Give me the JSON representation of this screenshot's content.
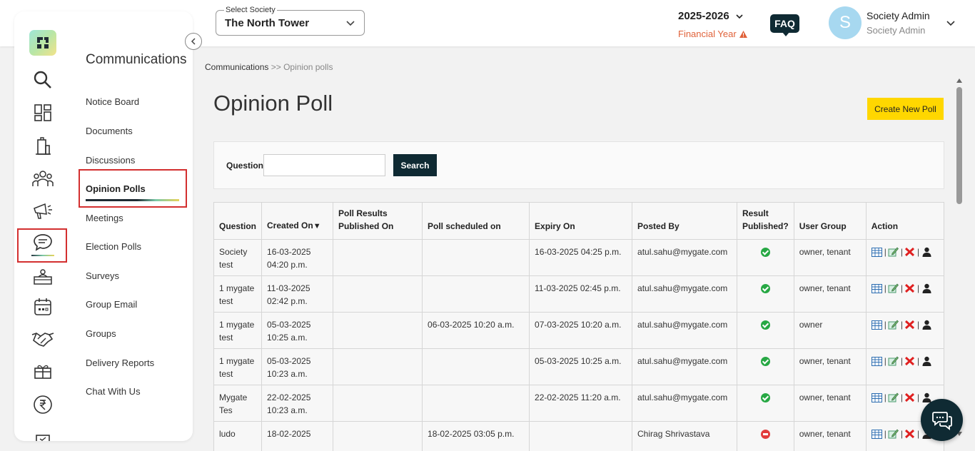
{
  "header": {
    "society_label": "Select Society",
    "society_value": "The North Tower",
    "fy_year": "2025-2026",
    "fy_label": "Financial Year",
    "faq": "FAQ",
    "avatar_letter": "S",
    "user_name": "Society Admin",
    "user_role": "Society Admin"
  },
  "sidebar": {
    "title": "Communications",
    "items": [
      {
        "label": "Notice Board"
      },
      {
        "label": "Documents"
      },
      {
        "label": "Discussions"
      },
      {
        "label": "Opinion Polls"
      },
      {
        "label": "Meetings"
      },
      {
        "label": "Election Polls"
      },
      {
        "label": "Surveys"
      },
      {
        "label": "Group Email"
      },
      {
        "label": "Groups"
      },
      {
        "label": "Delivery Reports"
      },
      {
        "label": "Chat With Us"
      }
    ],
    "rail_icons": [
      "search-icon",
      "dashboard-icon",
      "building-icon",
      "people-icon",
      "megaphone-icon",
      "chat-icon",
      "desk-icon",
      "calendar-icon",
      "handshake-icon",
      "gift-icon",
      "rupee-icon",
      "more-icon"
    ]
  },
  "main": {
    "breadcrumb_parent": "Communications",
    "breadcrumb_sep": " >> ",
    "breadcrumb_current": "Opinion polls",
    "title": "Opinion Poll",
    "create_button": "Create New Poll",
    "search_label": "Question",
    "search_placeholder": "",
    "search_button": "Search",
    "columns": {
      "question": "Question",
      "created_on": "Created On",
      "results_published_on": "Poll Results Published On",
      "scheduled_on": "Poll scheduled on",
      "expiry_on": "Expiry On",
      "posted_by": "Posted By",
      "result_published": "Result Published?",
      "user_group": "User Group",
      "action": "Action"
    },
    "rows": [
      {
        "question": "Society test",
        "created_on": "16-03-2025 04:20 p.m.",
        "results_published_on": "",
        "scheduled_on": "",
        "expiry_on": "16-03-2025 04:25 p.m.",
        "posted_by": "atul.sahu@mygate.com",
        "published": true,
        "user_group": "owner, tenant"
      },
      {
        "question": "1 mygate test",
        "created_on": "11-03-2025 02:42 p.m.",
        "results_published_on": "",
        "scheduled_on": "",
        "expiry_on": "11-03-2025 02:45 p.m.",
        "posted_by": "atul.sahu@mygate.com",
        "published": true,
        "user_group": "owner, tenant"
      },
      {
        "question": "1 mygate test",
        "created_on": "05-03-2025 10:25 a.m.",
        "results_published_on": "",
        "scheduled_on": "06-03-2025 10:20 a.m.",
        "expiry_on": "07-03-2025 10:20 a.m.",
        "posted_by": "atul.sahu@mygate.com",
        "published": true,
        "user_group": "owner"
      },
      {
        "question": "1 mygate test",
        "created_on": "05-03-2025 10:23 a.m.",
        "results_published_on": "",
        "scheduled_on": "",
        "expiry_on": "05-03-2025 10:25 a.m.",
        "posted_by": "atul.sahu@mygate.com",
        "published": true,
        "user_group": "owner, tenant"
      },
      {
        "question": "Mygate Tes",
        "created_on": "22-02-2025 10:23 a.m.",
        "results_published_on": "",
        "scheduled_on": "",
        "expiry_on": "22-02-2025 11:20 a.m.",
        "posted_by": "atul.sahu@mygate.com",
        "published": true,
        "user_group": "owner, tenant"
      },
      {
        "question": "ludo",
        "created_on": "18-02-2025",
        "results_published_on": "",
        "scheduled_on": "18-02-2025 03:05 p.m.",
        "expiry_on": "",
        "posted_by": "Chirag Shrivastava",
        "published": false,
        "user_group": "owner, tenant"
      }
    ]
  },
  "colors": {
    "accent_yellow": "#ffd700",
    "dark_navy": "#0f2a33",
    "alert_orange": "#e0623a",
    "active_outline": "#d32f2f"
  }
}
